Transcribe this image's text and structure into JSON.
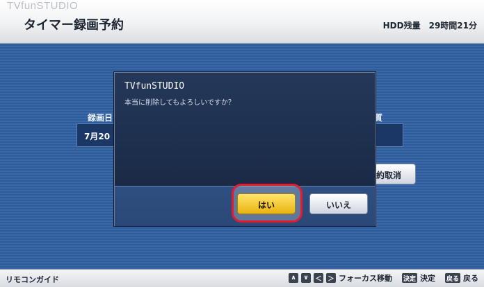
{
  "header": {
    "brand": "TVfunSTUDIO",
    "title": "タイマー録画予約",
    "hdd_label": "HDD残量",
    "hdd_value": "29時間21分"
  },
  "background_screen": {
    "col_record_date": "録画日",
    "col_quality_partial": "質",
    "date_value_partial": "7月20",
    "cancel_reservation_partial": "約取消"
  },
  "dialog": {
    "title": "TVfunSTUDIO",
    "message": "本当に削除してもよろしいですか？",
    "yes_label": "はい",
    "no_label": "いいえ"
  },
  "guide": {
    "label": "リモコンガイド",
    "keys": {
      "up": "∧",
      "down": "∨",
      "left": "＜",
      "right": "＞",
      "enter_key": "決定",
      "back_key": "戻る"
    },
    "focus_move": "フォーカス移動",
    "enter_text": "決定",
    "back_text": "戻る"
  },
  "colors": {
    "main_blue": "#2f5fa0",
    "dialog_dark": "#1b2c47",
    "yes_button": "#f5c823",
    "focus_ring": "#e41b2d"
  }
}
